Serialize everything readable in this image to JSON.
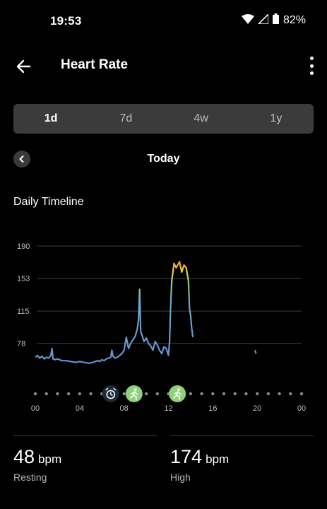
{
  "status": {
    "time": "19:53",
    "battery": "82%"
  },
  "app_bar": {
    "title": "Heart Rate"
  },
  "tabs": [
    {
      "label": "1d",
      "active": true
    },
    {
      "label": "7d",
      "active": false
    },
    {
      "label": "4w",
      "active": false
    },
    {
      "label": "1y",
      "active": false
    }
  ],
  "date_nav": {
    "label": "Today"
  },
  "section": {
    "title": "Daily Timeline"
  },
  "chart_data": {
    "type": "line",
    "title": "",
    "xlabel": "",
    "ylabel": "",
    "y_ticks": [
      "190",
      "153",
      "115",
      "78"
    ],
    "x_ticks": [
      "00",
      "04",
      "08",
      "12",
      "16",
      "20",
      "00"
    ],
    "xlim": [
      0,
      24
    ],
    "ylim": [
      50,
      190
    ],
    "grid": true,
    "colors": {
      "low": "#5f8fcf",
      "high": "#e84a3a",
      "mid": "#8fd07a",
      "grid": "#3d3d3d",
      "event_green": "#8fd07a",
      "event_dark": "#1c2a3a"
    },
    "series": [
      {
        "x": [
          0.0,
          0.2,
          0.4,
          0.6,
          0.8,
          1.0,
          1.2,
          1.4,
          1.5,
          1.6,
          1.8,
          2.0,
          2.4,
          2.8,
          3.2,
          3.6,
          4.0,
          4.4,
          4.8,
          5.2,
          5.6,
          5.8,
          6.0,
          6.2,
          6.4,
          6.6,
          6.8,
          6.9,
          7.0,
          7.2,
          7.4,
          7.6,
          7.8,
          8.0,
          8.2,
          8.4,
          8.6,
          8.8,
          9.0,
          9.2,
          9.3,
          9.4,
          9.5,
          9.6,
          9.8,
          10.0,
          10.2,
          10.4,
          10.6,
          10.8,
          11.0,
          11.2,
          11.4,
          11.6,
          11.8,
          12.0,
          12.1,
          12.2,
          12.3,
          12.5,
          12.7,
          13.0,
          13.2,
          13.4,
          13.6,
          13.8,
          13.9,
          14.0,
          14.1,
          14.2
        ],
        "y": [
          62,
          64,
          61,
          63,
          60,
          62,
          61,
          64,
          72,
          60,
          59,
          60,
          58,
          58,
          57,
          56,
          57,
          56,
          55,
          56,
          58,
          57,
          59,
          58,
          60,
          61,
          62,
          70,
          63,
          61,
          62,
          64,
          66,
          70,
          85,
          72,
          78,
          82,
          86,
          95,
          105,
          140,
          92,
          88,
          80,
          84,
          78,
          75,
          70,
          80,
          76,
          70,
          66,
          74,
          72,
          64,
          80,
          120,
          150,
          170,
          165,
          172,
          160,
          168,
          165,
          150,
          118,
          110,
          95,
          85
        ]
      },
      {
        "x": [
          19.8,
          19.9
        ],
        "y": [
          70,
          66
        ]
      }
    ],
    "events": [
      {
        "x": 6.8,
        "icon": "alarm-icon"
      },
      {
        "x": 8.9,
        "icon": "run-icon"
      },
      {
        "x": 12.8,
        "icon": "run-icon"
      }
    ]
  },
  "stats": [
    {
      "value": "48",
      "unit": "bpm",
      "label": "Resting"
    },
    {
      "value": "174",
      "unit": "bpm",
      "label": "High"
    }
  ]
}
